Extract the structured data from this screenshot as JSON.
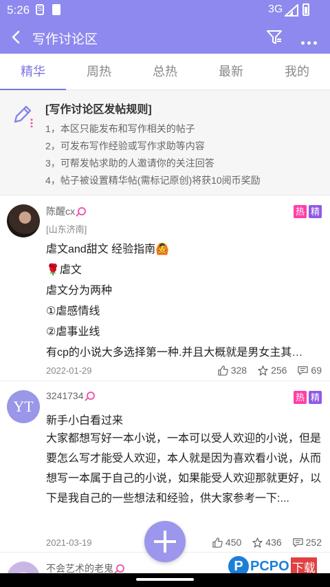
{
  "status_bar": {
    "time": "5:26",
    "s_glyph": "S",
    "network": "3G"
  },
  "header": {
    "title": "写作讨论区"
  },
  "tabs": [
    {
      "label": "精华"
    },
    {
      "label": "周热"
    },
    {
      "label": "总热"
    },
    {
      "label": "最新"
    },
    {
      "label": "我的"
    }
  ],
  "active_tab": "精华",
  "rules": {
    "title": "[写作讨论区发帖规则]",
    "items": [
      "1，本区只能发布和写作相关的帖子",
      "2，可发布写作经验或写作求助等内容",
      "3，可帮发帖求助的人邀请你的关注回答",
      "4，帖子被设置精华帖(需标记原创)将获10阅币奖励"
    ]
  },
  "posts": [
    {
      "author": "陈醒cx",
      "location": "[山东济南]",
      "badges": [
        "热",
        "精"
      ],
      "lines": [
        "虐文and甜文 经验指南🙆",
        "🌹虐文",
        "虐文分为两种",
        "①虐感情线",
        "②虐事业线",
        "有cp的小说大多选择第一种.并且大概就是男女主其…"
      ],
      "date": "2022-01-29",
      "likes": "328",
      "stars": "256",
      "comments": "69"
    },
    {
      "author": "3241734",
      "avatar_text": "YT",
      "badges": [
        "热",
        "精"
      ],
      "title": "新手小白看过来",
      "body": "大家都想写好一本小说，一本可以受人欢迎的小说，但是要怎么写才能受人欢迎，本人就是因为喜欢看小说，从而想写一本属于自己的小说，如果能受人欢迎那就更好，以下是我自己的一些想法和经验，供大家参考一下:...",
      "date": "2021-03-19",
      "likes": "450",
      "stars": "436",
      "comments": "252"
    },
    {
      "author": "不会艺术的老鬼"
    }
  ],
  "watermark": {
    "logo": "P",
    "text": "PCPO",
    "cn": "下载"
  },
  "colors": {
    "accent": "#8e89ee",
    "hot": "#ff3fa6",
    "essence": "#8f58e6",
    "female": "#f05aa8"
  }
}
